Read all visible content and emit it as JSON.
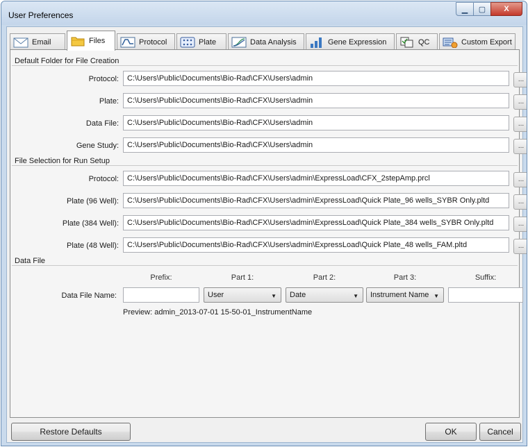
{
  "window": {
    "title": "User Preferences",
    "minimize_glyph": "▁",
    "maximize_glyph": "▢",
    "close_glyph": "X"
  },
  "tabs": [
    {
      "label": "Email",
      "icon": "envelope-icon",
      "active": false
    },
    {
      "label": "Files",
      "icon": "folder-icon",
      "active": true
    },
    {
      "label": "Protocol",
      "icon": "protocol-curve-icon",
      "active": false
    },
    {
      "label": "Plate",
      "icon": "plate-grid-icon",
      "active": false
    },
    {
      "label": "Data Analysis",
      "icon": "amplification-curve-icon",
      "active": false
    },
    {
      "label": "Gene Expression",
      "icon": "bar-chart-icon",
      "active": false
    },
    {
      "label": "QC",
      "icon": "qc-check-icon",
      "active": false
    },
    {
      "label": "Custom Export",
      "icon": "export-icon",
      "active": false
    }
  ],
  "default_folder": {
    "title": "Default Folder for File Creation",
    "rows": [
      {
        "label": "Protocol:",
        "value": "C:\\Users\\Public\\Documents\\Bio-Rad\\CFX\\Users\\admin"
      },
      {
        "label": "Plate:",
        "value": "C:\\Users\\Public\\Documents\\Bio-Rad\\CFX\\Users\\admin"
      },
      {
        "label": "Data File:",
        "value": "C:\\Users\\Public\\Documents\\Bio-Rad\\CFX\\Users\\admin"
      },
      {
        "label": "Gene Study:",
        "value": "C:\\Users\\Public\\Documents\\Bio-Rad\\CFX\\Users\\admin"
      }
    ]
  },
  "run_setup": {
    "title": "File Selection for Run Setup",
    "rows": [
      {
        "label": "Protocol:",
        "value": "C:\\Users\\Public\\Documents\\Bio-Rad\\CFX\\Users\\admin\\ExpressLoad\\CFX_2stepAmp.prcl"
      },
      {
        "label": "Plate (96 Well):",
        "value": "C:\\Users\\Public\\Documents\\Bio-Rad\\CFX\\Users\\admin\\ExpressLoad\\Quick Plate_96 wells_SYBR Only.pltd"
      },
      {
        "label": "Plate (384 Well):",
        "value": "C:\\Users\\Public\\Documents\\Bio-Rad\\CFX\\Users\\admin\\ExpressLoad\\Quick Plate_384 wells_SYBR Only.pltd"
      },
      {
        "label": "Plate (48 Well):",
        "value": "C:\\Users\\Public\\Documents\\Bio-Rad\\CFX\\Users\\admin\\ExpressLoad\\Quick Plate_48 wells_FAM.pltd"
      }
    ]
  },
  "browse_label": "...",
  "data_file": {
    "title": "Data File",
    "name_label": "Data File Name:",
    "prefix_label": "Prefix:",
    "part1_label": "Part 1:",
    "part2_label": "Part 2:",
    "part3_label": "Part 3:",
    "suffix_label": "Suffix:",
    "prefix_value": "",
    "part1_value": "User",
    "part2_value": "Date",
    "part3_value": "Instrument Name",
    "suffix_value": "",
    "preview": "Preview: admin_2013-07-01 15-50-01_InstrumentName"
  },
  "buttons": {
    "restore": "Restore Defaults",
    "ok": "OK",
    "cancel": "Cancel"
  }
}
